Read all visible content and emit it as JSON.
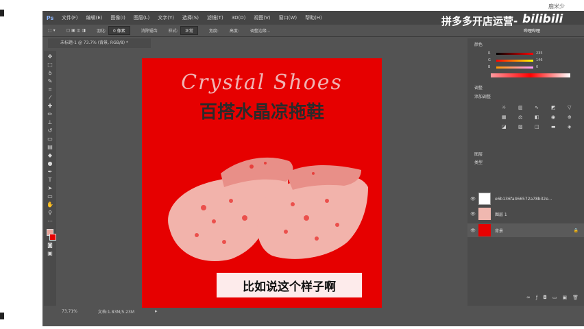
{
  "menubar": {
    "logo": "Ps",
    "items": [
      "文件(F)",
      "编辑(E)",
      "图像(I)",
      "图层(L)",
      "文字(Y)",
      "选择(S)",
      "滤镜(T)",
      "3D(D)",
      "视图(V)",
      "窗口(W)",
      "帮助(H)"
    ]
  },
  "options": {
    "feather_label": "羽化:",
    "feather_value": "0 像素",
    "antialias_label": "消除锯齿",
    "style_label": "样式:",
    "style_value": "正常",
    "width_label": "宽度:",
    "height_label": "高度:",
    "refine_label": "调整边缘..."
  },
  "document": {
    "tab_label": "未标题-1 @ 73.7% (背景, RGB/8) *",
    "title_en": "Crystal Shoes",
    "title_cn": "百搭水晶凉拖鞋"
  },
  "status": {
    "zoom": "73.71%",
    "doc_size": "文档:1.83M/5.23M",
    "arrow": "▸"
  },
  "panels": {
    "color_tab": "颜色",
    "sliders": [
      {
        "label": "R",
        "value": "235",
        "color": "#ff6b6b"
      },
      {
        "label": "G",
        "value": "146",
        "color": "#f0a0a0"
      },
      {
        "label": "B",
        "value": "0",
        "color": "#e0e0e0"
      }
    ],
    "adjust_tab": "调整",
    "adjust_add": "添加调整",
    "layers_tab": "图层",
    "kind_label": "类型",
    "layers": [
      {
        "name": "e6b136fa466572a78b32e...",
        "thumb": "#ffffff"
      },
      {
        "name": "图层 1",
        "thumb": "#f0b8b0"
      },
      {
        "name": "背景",
        "thumb": "#e60000"
      }
    ]
  },
  "overlay": {
    "promo": "拼多多开店运营-",
    "bili": "bilibili",
    "bili_sub": "哔哩哔哩",
    "watermark": "鹿米少",
    "subtitle": "比如说这个样子啊"
  },
  "colors": {
    "canvas_bg": "#e60000",
    "shoe": "#f2b3ab",
    "ps_bg": "#535353"
  }
}
